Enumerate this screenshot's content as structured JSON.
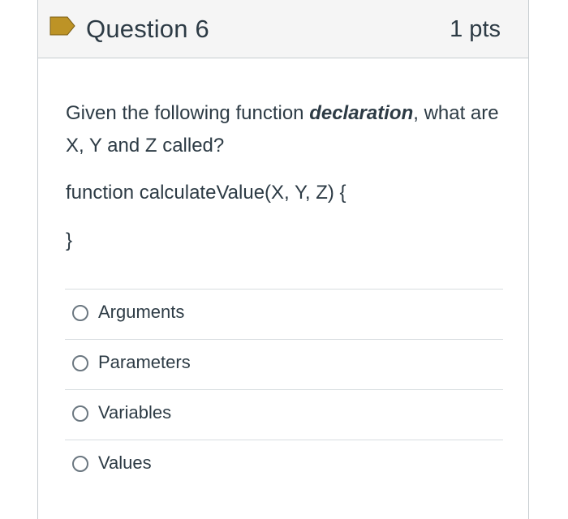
{
  "question": {
    "title": "Question 6",
    "points": "1 pts",
    "prompt_part1": "Given the following function ",
    "prompt_emphasis": "declaration",
    "prompt_part2": ", what are X, Y and Z called?",
    "code_line": "function calculateValue(X, Y, Z) {",
    "code_close": "}",
    "flag_color": "#bd9326"
  },
  "answers": [
    {
      "label": "Arguments"
    },
    {
      "label": "Parameters"
    },
    {
      "label": "Variables"
    },
    {
      "label": "Values"
    }
  ]
}
